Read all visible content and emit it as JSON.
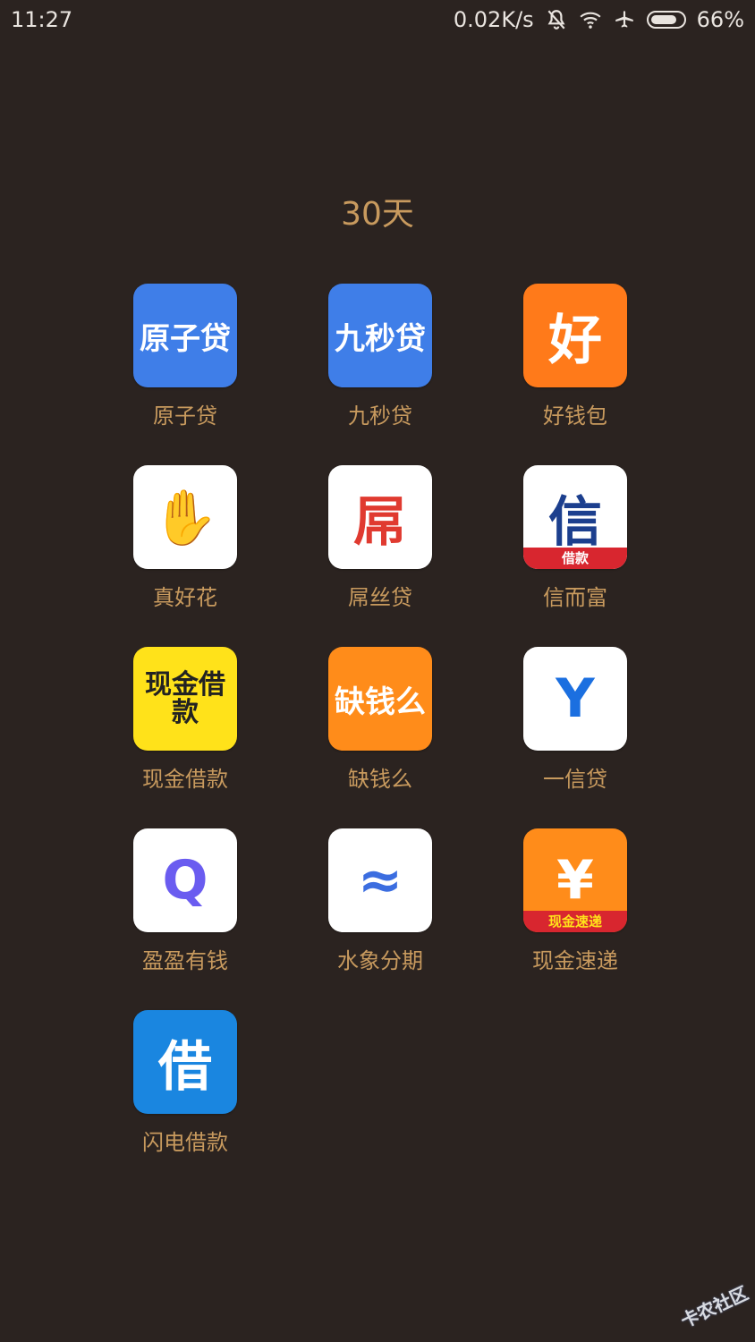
{
  "status_bar": {
    "time": "11:27",
    "net_speed": "0.02K/s",
    "battery_percent": "66%",
    "battery_level": 0.66,
    "icons": [
      "bell-off-icon",
      "wifi-icon",
      "airplane-icon",
      "battery-icon"
    ]
  },
  "folder": {
    "title": "30天"
  },
  "apps": [
    {
      "label": "原子贷",
      "icon_text": "原子贷",
      "bg": "#3f7ee8",
      "fg": "#ffffff"
    },
    {
      "label": "九秒贷",
      "icon_text": "九秒贷",
      "bg": "#3f7ee8",
      "fg": "#ffffff"
    },
    {
      "label": "好钱包",
      "icon_text": "好",
      "bg": "#ff7a1a",
      "fg": "#ffffff"
    },
    {
      "label": "真好花",
      "icon_text": "✋",
      "bg": "#ffffff",
      "fg": "#e8503a"
    },
    {
      "label": "屌丝贷",
      "icon_text": "屌",
      "bg": "#ffffff",
      "fg": "#e03a30"
    },
    {
      "label": "信而富",
      "icon_text": "信",
      "icon_subtext": "借款",
      "bg": "#ffffff",
      "fg": "#1c3f8e"
    },
    {
      "label": "现金借款",
      "icon_text": "现金借款",
      "bg": "#ffe21a",
      "fg": "#222222"
    },
    {
      "label": "缺钱么",
      "icon_text": "缺钱么",
      "bg": "#ff8c1a",
      "fg": "#ffffff"
    },
    {
      "label": "一信贷",
      "icon_text": "Y",
      "bg": "#ffffff",
      "fg": "#1b6fe0"
    },
    {
      "label": "盈盈有钱",
      "icon_text": "Q",
      "bg": "#ffffff",
      "fg": "#6a5cf0"
    },
    {
      "label": "水象分期",
      "icon_text": "≈",
      "bg": "#ffffff",
      "fg": "#3b6de0"
    },
    {
      "label": "现金速递",
      "icon_text": "¥",
      "icon_subtext": "现金速递",
      "bg": "#ff8c1a",
      "fg": "#ffffff"
    },
    {
      "label": "闪电借款",
      "icon_text": "借",
      "bg": "#1a86e0",
      "fg": "#ffffff"
    }
  ],
  "watermark": {
    "text": "卡农社区"
  }
}
